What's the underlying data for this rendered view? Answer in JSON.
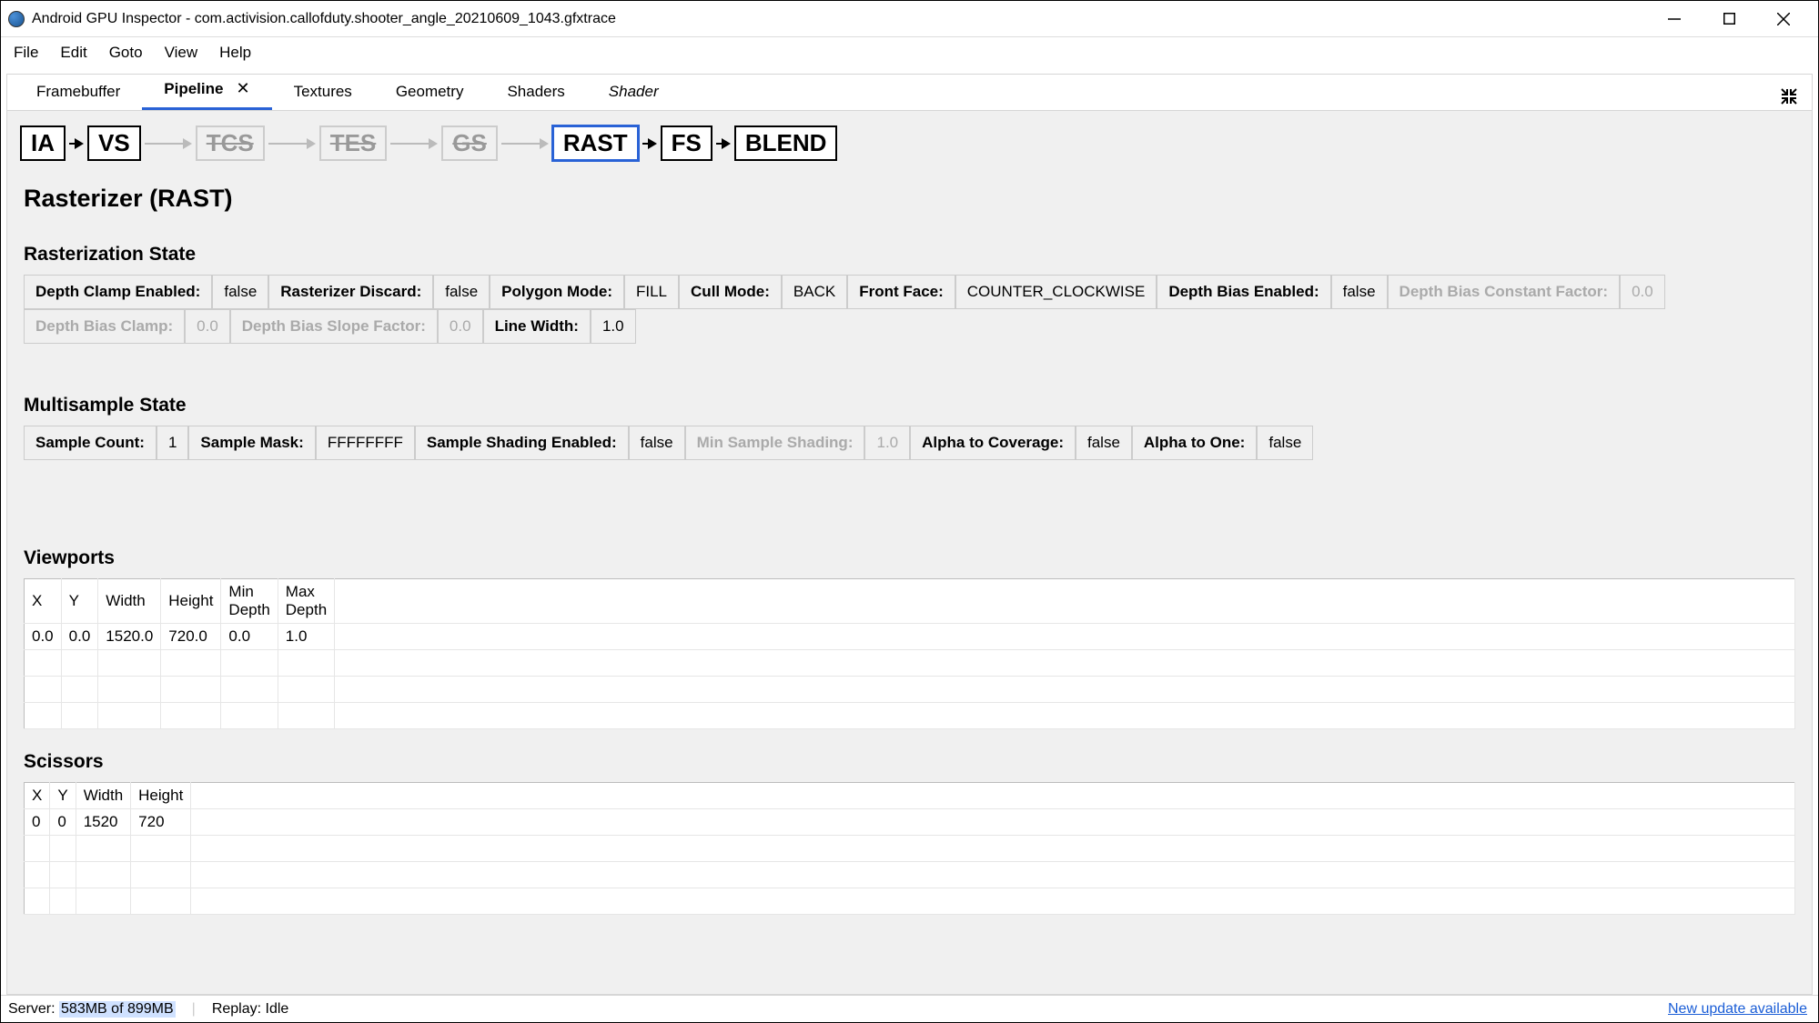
{
  "window": {
    "title": "Android GPU Inspector - com.activision.callofduty.shooter_angle_20210609_1043.gfxtrace"
  },
  "menu": {
    "items": [
      "File",
      "Edit",
      "Goto",
      "View",
      "Help"
    ]
  },
  "tabs": {
    "items": [
      {
        "label": "Framebuffer",
        "active": false,
        "closable": false
      },
      {
        "label": "Pipeline",
        "active": true,
        "closable": true
      },
      {
        "label": "Textures",
        "active": false,
        "closable": false
      },
      {
        "label": "Geometry",
        "active": false,
        "closable": false
      },
      {
        "label": "Shaders",
        "active": false,
        "closable": false
      },
      {
        "label": "Shader",
        "active": false,
        "closable": false,
        "italic": true
      }
    ]
  },
  "pipeline": {
    "stages": [
      {
        "label": "IA",
        "disabled": false,
        "selected": false
      },
      {
        "label": "VS",
        "disabled": false,
        "selected": false
      },
      {
        "label": "TCS",
        "disabled": true,
        "selected": false
      },
      {
        "label": "TES",
        "disabled": true,
        "selected": false
      },
      {
        "label": "GS",
        "disabled": true,
        "selected": false
      },
      {
        "label": "RAST",
        "disabled": false,
        "selected": true
      },
      {
        "label": "FS",
        "disabled": false,
        "selected": false
      },
      {
        "label": "BLEND",
        "disabled": false,
        "selected": false
      }
    ]
  },
  "section": {
    "title": "Rasterizer (RAST)",
    "rasterization_title": "Rasterization State",
    "rasterization": [
      [
        {
          "label": "Depth Clamp Enabled:",
          "value": "false",
          "disabled": false
        },
        {
          "label": "Rasterizer Discard:",
          "value": "false",
          "disabled": false
        },
        {
          "label": "Polygon Mode:",
          "value": "FILL",
          "disabled": false
        },
        {
          "label": "Cull Mode:",
          "value": "BACK",
          "disabled": false
        },
        {
          "label": "Front Face:",
          "value": "COUNTER_CLOCKWISE",
          "disabled": false
        },
        {
          "label": "Depth Bias Enabled:",
          "value": "false",
          "disabled": false
        },
        {
          "label": "Depth Bias Constant Factor:",
          "value": "0.0",
          "disabled": true
        }
      ],
      [
        {
          "label": "Depth Bias Clamp:",
          "value": "0.0",
          "disabled": true
        },
        {
          "label": "Depth Bias Slope Factor:",
          "value": "0.0",
          "disabled": true
        },
        {
          "label": "Line Width:",
          "value": "1.0",
          "disabled": false
        }
      ]
    ],
    "multisample_title": "Multisample State",
    "multisample": [
      [
        {
          "label": "Sample Count:",
          "value": "1",
          "disabled": false
        },
        {
          "label": "Sample Mask:",
          "value": "FFFFFFFF",
          "disabled": false
        },
        {
          "label": "Sample Shading Enabled:",
          "value": "false",
          "disabled": false
        },
        {
          "label": "Min Sample Shading:",
          "value": "1.0",
          "disabled": true
        },
        {
          "label": "Alpha to Coverage:",
          "value": "false",
          "disabled": false
        },
        {
          "label": "Alpha to One:",
          "value": "false",
          "disabled": false
        }
      ]
    ],
    "viewports_title": "Viewports",
    "viewports": {
      "headers": [
        "X",
        "Y",
        "Width",
        "Height",
        "Min Depth",
        "Max Depth"
      ],
      "rows": [
        [
          "0.0",
          "0.0",
          "1520.0",
          "720.0",
          "0.0",
          "1.0"
        ]
      ]
    },
    "scissors_title": "Scissors",
    "scissors": {
      "headers": [
        "X",
        "Y",
        "Width",
        "Height"
      ],
      "rows": [
        [
          "0",
          "0",
          "1520",
          "720"
        ]
      ]
    }
  },
  "status": {
    "server_label": "Server:",
    "server_value": "583MB of 899MB",
    "replay_label": "Replay:",
    "replay_value": "Idle",
    "update": "New update available"
  }
}
